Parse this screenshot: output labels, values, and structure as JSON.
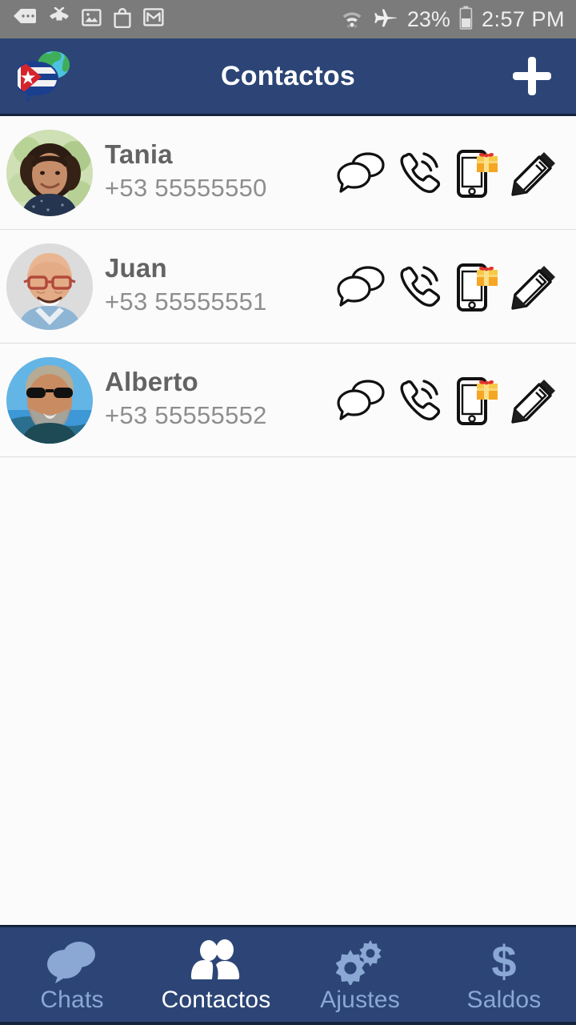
{
  "status_bar": {
    "notifications": [
      {
        "name": "sms-icon",
        "label": "SMS"
      },
      {
        "name": "missed-call-icon",
        "label": "Missed call"
      },
      {
        "name": "image-icon",
        "label": "Image"
      },
      {
        "name": "shopping-bag-icon",
        "label": "Play Store"
      },
      {
        "name": "gmail-icon",
        "label": "Gmail"
      }
    ],
    "wifi": "wifi-icon",
    "airplane": "airplane-mode-icon",
    "battery_percent": "23%",
    "battery": "battery-icon",
    "clock": "2:57 PM"
  },
  "app_bar": {
    "logo": "cuba-globe-chat-logo",
    "title": "Contactos",
    "add_button": "+",
    "background_color": "#2c4576"
  },
  "contacts": [
    {
      "name": "Tania",
      "phone": "+53 55555550",
      "avatar": "photo-woman-curly-hair",
      "actions": [
        {
          "name": "chat-icon",
          "label": "Chat"
        },
        {
          "name": "call-icon",
          "label": "Llamar"
        },
        {
          "name": "recharge-gift-icon",
          "label": "Recarga"
        },
        {
          "name": "edit-pencil-icon",
          "label": "Editar"
        }
      ]
    },
    {
      "name": "Juan",
      "phone": "+53 55555551",
      "avatar": "photo-bald-man-glasses",
      "actions": [
        {
          "name": "chat-icon",
          "label": "Chat"
        },
        {
          "name": "call-icon",
          "label": "Llamar"
        },
        {
          "name": "recharge-gift-icon",
          "label": "Recarga"
        },
        {
          "name": "edit-pencil-icon",
          "label": "Editar"
        }
      ]
    },
    {
      "name": "Alberto",
      "phone": "+53 55555552",
      "avatar": "photo-man-sunglasses-beard",
      "actions": [
        {
          "name": "chat-icon",
          "label": "Chat"
        },
        {
          "name": "call-icon",
          "label": "Llamar"
        },
        {
          "name": "recharge-gift-icon",
          "label": "Recarga"
        },
        {
          "name": "edit-pencil-icon",
          "label": "Editar"
        }
      ]
    }
  ],
  "bottom_nav": {
    "items": [
      {
        "label": "Chats",
        "icon": "chat-bubbles-icon",
        "active": false
      },
      {
        "label": "Contactos",
        "icon": "people-icon",
        "active": true
      },
      {
        "label": "Ajustes",
        "icon": "gears-icon",
        "active": false
      },
      {
        "label": "Saldos",
        "icon": "dollar-icon",
        "active": false
      }
    ],
    "active_color": "#ffffff",
    "inactive_color": "#8ba7d4",
    "background_color": "#2c4576"
  }
}
